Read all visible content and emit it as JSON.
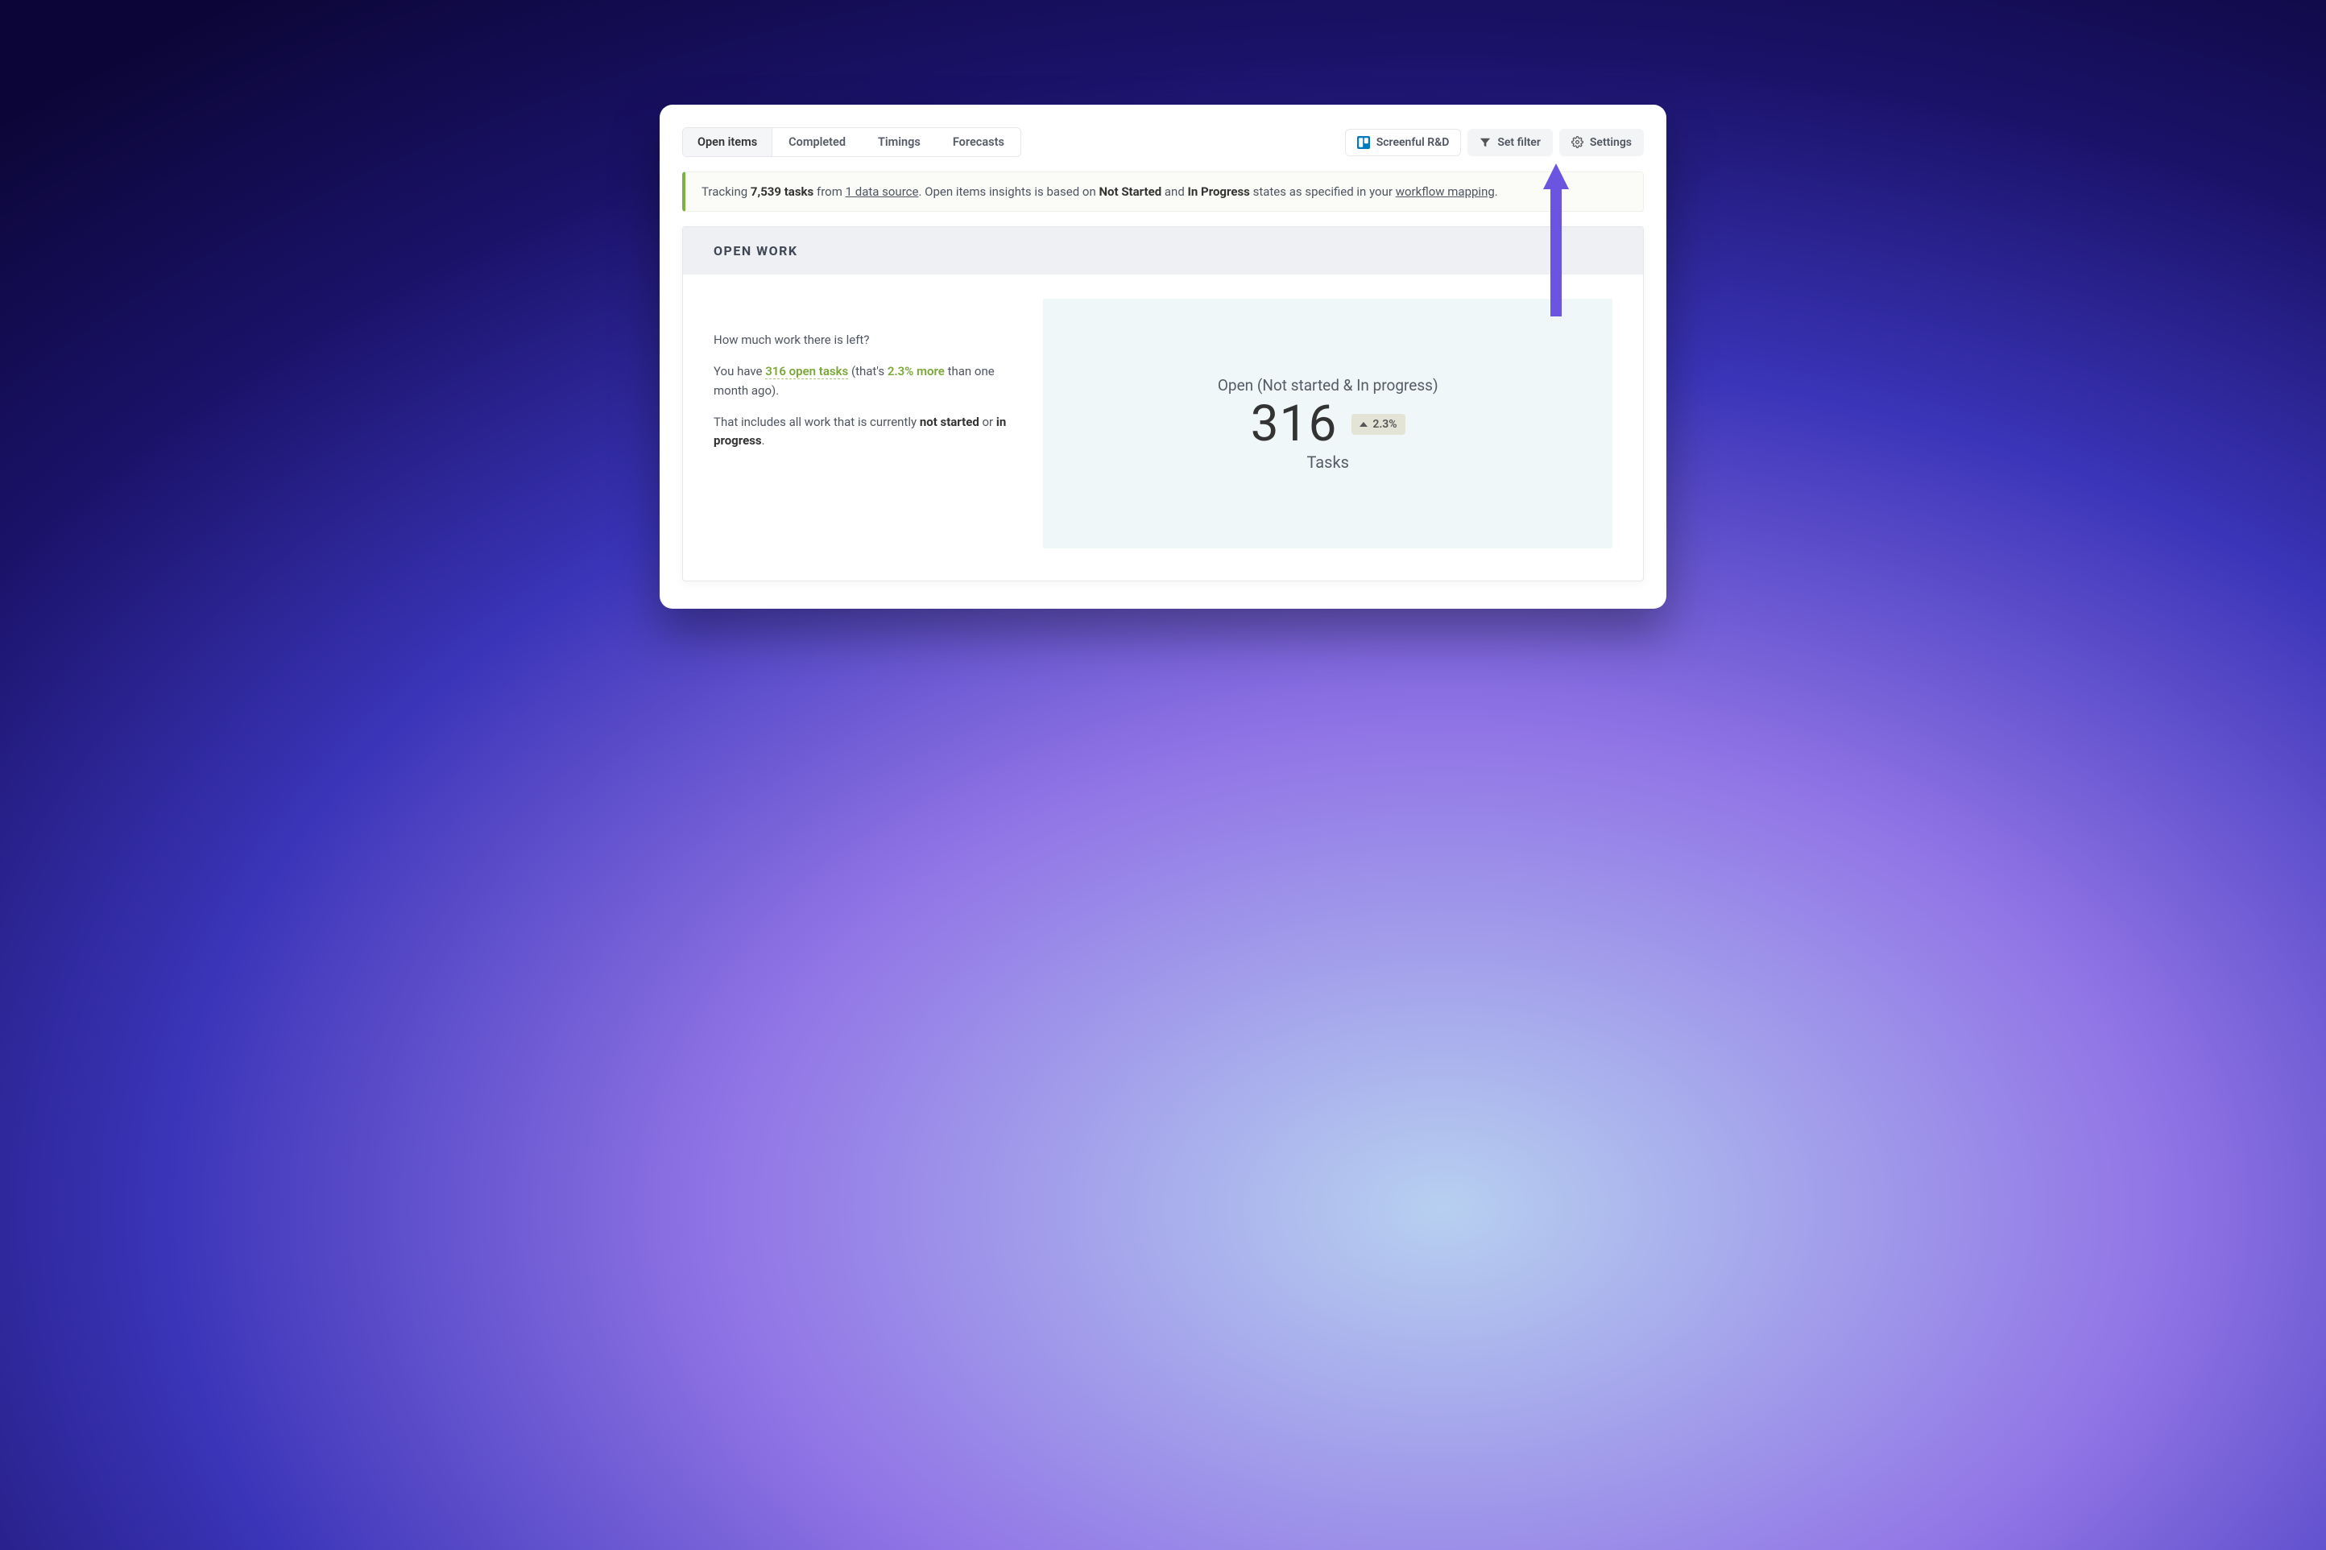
{
  "tabs": {
    "open_items": "Open items",
    "completed": "Completed",
    "timings": "Timings",
    "forecasts": "Forecasts"
  },
  "toolbar": {
    "source_label": "Screenful R&D",
    "filter_label": "Set filter",
    "settings_label": "Settings"
  },
  "banner": {
    "pre": "Tracking ",
    "count": "7,539 tasks",
    "mid1": " from ",
    "src": "1 data source",
    "mid2": ". Open items insights is based on ",
    "state1": "Not Started",
    "mid3": " and ",
    "state2": "In Progress",
    "mid4": " states as specified in your ",
    "mapping": "workflow mapping",
    "end": "."
  },
  "card": {
    "title": "OPEN WORK",
    "p1": "How much work there is left?",
    "p2_a": "You have ",
    "p2_link": "316 open tasks",
    "p2_b": " (that's ",
    "p2_pct": "2.3% more",
    "p2_c": " than one month ago).",
    "p3_a": "That includes all work that is currently ",
    "p3_b": "not started",
    "p3_c": " or ",
    "p3_d": "in progress",
    "p3_e": "."
  },
  "viz": {
    "title": "Open (Not started & In progress)",
    "value": "316",
    "delta": "2.3%",
    "unit": "Tasks"
  }
}
